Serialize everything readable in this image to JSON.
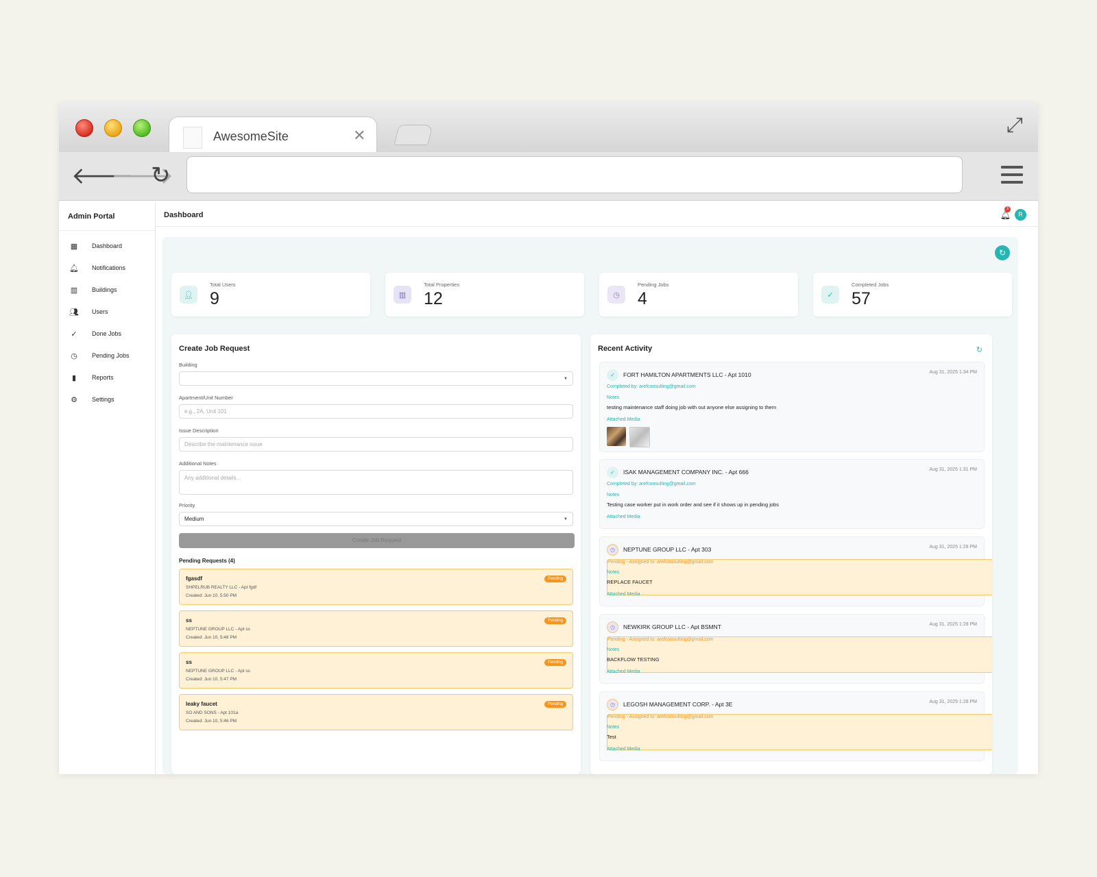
{
  "browser": {
    "tab_title": "AwesomeSite",
    "url": ""
  },
  "app": {
    "brand": "Admin Portal",
    "page_title": "Dashboard",
    "notification_count": "3",
    "avatar_initial": "R"
  },
  "sidebar": {
    "items": [
      {
        "label": "Dashboard",
        "icon": "dashboard-icon"
      },
      {
        "label": "Notifications",
        "icon": "bell-icon"
      },
      {
        "label": "Buildings",
        "icon": "building-icon"
      },
      {
        "label": "Users",
        "icon": "users-icon"
      },
      {
        "label": "Done Jobs",
        "icon": "check-circle-icon"
      },
      {
        "label": "Pending Jobs",
        "icon": "clock-icon"
      },
      {
        "label": "Reports",
        "icon": "bar-chart-icon"
      },
      {
        "label": "Settings",
        "icon": "gear-icon"
      }
    ]
  },
  "stats": [
    {
      "label": "Total Users",
      "value": "9",
      "icon": "user-icon",
      "color": "#26b5b0"
    },
    {
      "label": "Total Properties",
      "value": "12",
      "icon": "building-icon",
      "color": "#7b6fc4"
    },
    {
      "label": "Pending Jobs",
      "value": "4",
      "icon": "clock-icon",
      "color": "#8b7fb5"
    },
    {
      "label": "Completed Jobs",
      "value": "57",
      "icon": "check-circle-icon",
      "color": "#26b5b0"
    }
  ],
  "job_form": {
    "title": "Create Job Request",
    "building_label": "Building",
    "building_value": "",
    "unit_label": "Apartment/Unit Number",
    "unit_placeholder": "e.g., 2A, Unit 101",
    "issue_label": "Issue Description",
    "issue_placeholder": "Describe the maintenance issue",
    "notes_label": "Additional Notes",
    "notes_placeholder": "Any additional details...",
    "priority_label": "Priority",
    "priority_value": "Medium",
    "submit_label": "Create Job Request",
    "pending_title": "Pending Requests (4)"
  },
  "pending_requests": [
    {
      "name": "fgasdf",
      "building": "SHPELRUB REALTY LLC - Apt fgdf",
      "created": "Created: Jun 10, 5:50 PM",
      "badge": "Pending"
    },
    {
      "name": "ss",
      "building": "NEPTUNE GROUP LLC - Apt ss",
      "created": "Created: Jun 10, 5:48 PM",
      "badge": "Pending"
    },
    {
      "name": "ss",
      "building": "NEPTUNE GROUP LLC - Apt ss",
      "created": "Created: Jun 10, 5:47 PM",
      "badge": "Pending"
    },
    {
      "name": "leaky faucet",
      "building": "SO AND SONS - Apt 101a",
      "created": "Created: Jun 10, 5:46 PM",
      "badge": "Pending"
    }
  ],
  "activity": {
    "title": "Recent Activity",
    "items": [
      {
        "title": "FORT HAMILTON APARTMENTS LLC - Apt 1010",
        "date": "Aug 31, 2025 1:34 PM",
        "status": "Completed by: arefconsulting@gmail.com",
        "state": "done",
        "notes_label": "Notes",
        "note": "testing maintenance staff doing job with out anyone else assigning to them",
        "media_label": "Attached Media"
      },
      {
        "title": "ISAK MANAGEMENT COMPANY INC. - Apt 666",
        "date": "Aug 31, 2025 1:31 PM",
        "status": "Completed by: arefconsulting@gmail.com",
        "state": "done",
        "notes_label": "Notes",
        "note": "Testing case worker put in work order and see if it shows up in pending jobs",
        "media_label": "Attached Media"
      },
      {
        "title": "NEPTUNE GROUP LLC - Apt 303",
        "date": "Aug 31, 2025 1:28 PM",
        "status": "Pending - Assigned to: arefconsulting@gmail.com",
        "state": "pending",
        "notes_label": "Notes",
        "note": "REPLACE FAUCET",
        "media_label": "Attached Media"
      },
      {
        "title": "NEWKIRK GROUP LLC - Apt BSMNT",
        "date": "Aug 31, 2025 1:28 PM",
        "status": "Pending - Assigned to: arefconsulting@gmail.com",
        "state": "pending",
        "notes_label": "Notes",
        "note": "BACKFLOW TESTING",
        "media_label": "Attached Media"
      },
      {
        "title": "LEGOSH MANAGEMENT CORP. - Apt 3E",
        "date": "Aug 31, 2025 1:28 PM",
        "status": "Pending - Assigned to: arefconsulting@gmail.com",
        "state": "pending",
        "notes_label": "Notes",
        "note": "Test",
        "media_label": "Attached Media"
      }
    ]
  },
  "colors": {
    "accent": "#26b5b0",
    "pending": "#f7941d",
    "pending_bg": "#fff1d6"
  }
}
